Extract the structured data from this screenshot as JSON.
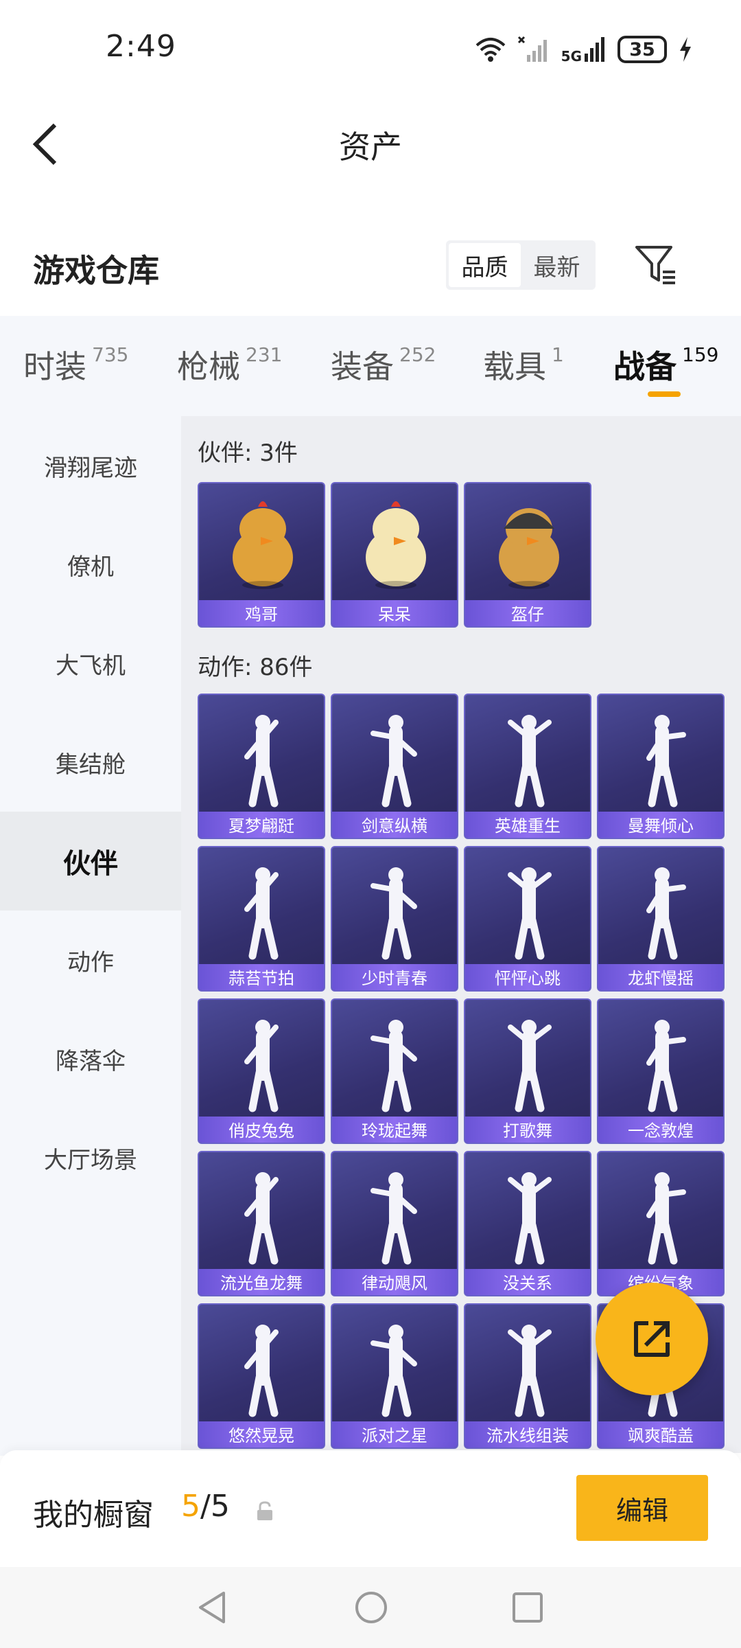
{
  "status_bar": {
    "time": "2:49",
    "network": "5G",
    "battery": "35"
  },
  "header": {
    "title": "资产"
  },
  "warehouse": {
    "title": "游戏仓库",
    "sort_options": [
      "品质",
      "最新"
    ],
    "active_sort": "品质"
  },
  "category_tabs": [
    {
      "label": "时装",
      "count": "735"
    },
    {
      "label": "枪械",
      "count": "231"
    },
    {
      "label": "装备",
      "count": "252"
    },
    {
      "label": "载具",
      "count": "1"
    },
    {
      "label": "战备",
      "count": "159"
    }
  ],
  "active_category": "战备",
  "sidebar": {
    "items": [
      "滑翔尾迹",
      "僚机",
      "大飞机",
      "集结舱",
      "伙伴",
      "动作",
      "降落伞",
      "大厅场景"
    ],
    "active": "伙伴"
  },
  "groups": [
    {
      "label": "伙伴: 3件",
      "items": [
        "鸡哥",
        "呆呆",
        "盔仔"
      ]
    },
    {
      "label": "动作: 86件",
      "items": [
        "夏梦翩跹",
        "剑意纵横",
        "英雄重生",
        "曼舞倾心",
        "蒜苔节拍",
        "少时青春",
        "怦怦心跳",
        "龙虾慢摇",
        "俏皮兔兔",
        "玲珑起舞",
        "打歌舞",
        "一念敦煌",
        "流光鱼龙舞",
        "律动飓风",
        "没关系",
        "缤纷气象",
        "悠然晃晃",
        "派对之星",
        "流水线组装",
        "飒爽酷盖"
      ]
    }
  ],
  "bottom_bar": {
    "label": "我的橱窗",
    "count_current": "5",
    "count_total": "/5",
    "edit_label": "编辑"
  },
  "colors": {
    "accent": "#f9b51a",
    "card_bg": "#3a3680",
    "card_label_bg": "#7b61e6"
  },
  "icons": {
    "back": "back-arrow-icon",
    "filter": "filter-icon",
    "fab": "share-export-icon",
    "lock": "lock-icon"
  }
}
